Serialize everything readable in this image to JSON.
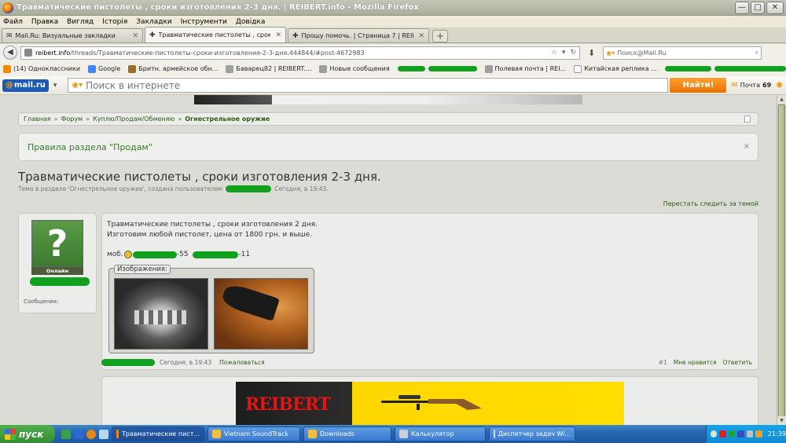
{
  "window": {
    "title": "Травматические пистолеты , сроки изготовления 2-3 дня. | REIBERT.info - Mozilla Firefox",
    "minimize": "—",
    "maximize": "□",
    "close": "✕"
  },
  "menu": [
    "Файл",
    "Правка",
    "Вигляд",
    "Історія",
    "Закладки",
    "Інструменти",
    "Довідка"
  ],
  "tabs": [
    {
      "label": "Mail.Ru: Визуальные закладки",
      "active": false
    },
    {
      "label": "Травматические пистолеты , сроки изго...",
      "active": true
    },
    {
      "label": "Прошу помочь. | Страница 7 | REIBERT....",
      "active": false
    }
  ],
  "navbar": {
    "url_domain": "reibert.info",
    "url_path": "/threads/Травматические-пистолеты-сроки-изготовления-2-3-дня.444844/#post-4672983",
    "search_placeholder": "Поиск@Mail.Ru"
  },
  "bookmarks": [
    {
      "label": "(14) Одноклассники",
      "color": "#f08a00"
    },
    {
      "label": "Google",
      "color": "#4285f4"
    },
    {
      "label": "Бритн. армейское обн...",
      "color": "#9c6c2c"
    },
    {
      "label": "Баварец82 | REIBERT....",
      "color": "#9e9e9e"
    },
    {
      "label": "Новые сообщения",
      "color": "#9e9e9e"
    },
    {
      "label": "Полевая почта | REI...",
      "color": "#9e9e9e"
    },
    {
      "label": "Китайская реплика ...",
      "color": "#ffffff"
    }
  ],
  "mailbar": {
    "logo_at": "@",
    "logo_text": "mail.ru",
    "search_placeholder": "Поиск в интернете",
    "find_button": "Найти!",
    "mail_label": "Почта",
    "mail_count": "69"
  },
  "breadcrumbs": [
    "Главная",
    "Форум",
    "Куплю/Продам/Обменяю",
    "Огнестрельное оружие"
  ],
  "rules_notice": "Правила раздела \"Продам\"",
  "rules_close": "×",
  "thread": {
    "title": "Травматические пистолеты , сроки изготовления 2-3 дня.",
    "meta_prefix": "Тема в разделе 'Огнестрельное оружие', создана пользователем",
    "meta_time": "Сегодня, в 19:43.",
    "stop_watching": "Перестать следить за темой"
  },
  "user": {
    "avatar_symbol": "?",
    "status": "Онлайн",
    "messages_label": "Сообщения:"
  },
  "post": {
    "line1": "Травматические пистолеты , сроки изготовления 2 дня.",
    "line2": "Изготовим любой пистолет, цена от 1800 грн. и выше.",
    "phone_prefix": "моб.",
    "phone_mid": "-55",
    "phone_end": "-11",
    "attachments_label": "Изображения:",
    "date": "Сегодня, в 19:43",
    "report": "Пожаловаться",
    "number": "#1",
    "like": "Мне нравится",
    "reply": "Ответить"
  },
  "ad": {
    "logo": "REIBERT"
  },
  "taskbar": {
    "start": "пуск",
    "tasks": [
      {
        "label": "Травматические пист...",
        "active": true
      },
      {
        "label": "Vietnam SoundTrack",
        "active": false
      },
      {
        "label": "Downloads",
        "active": false
      },
      {
        "label": "Калькулятор",
        "active": false
      },
      {
        "label": "Диспетчер задач Wi...",
        "active": false
      }
    ],
    "clock": "21:39"
  }
}
